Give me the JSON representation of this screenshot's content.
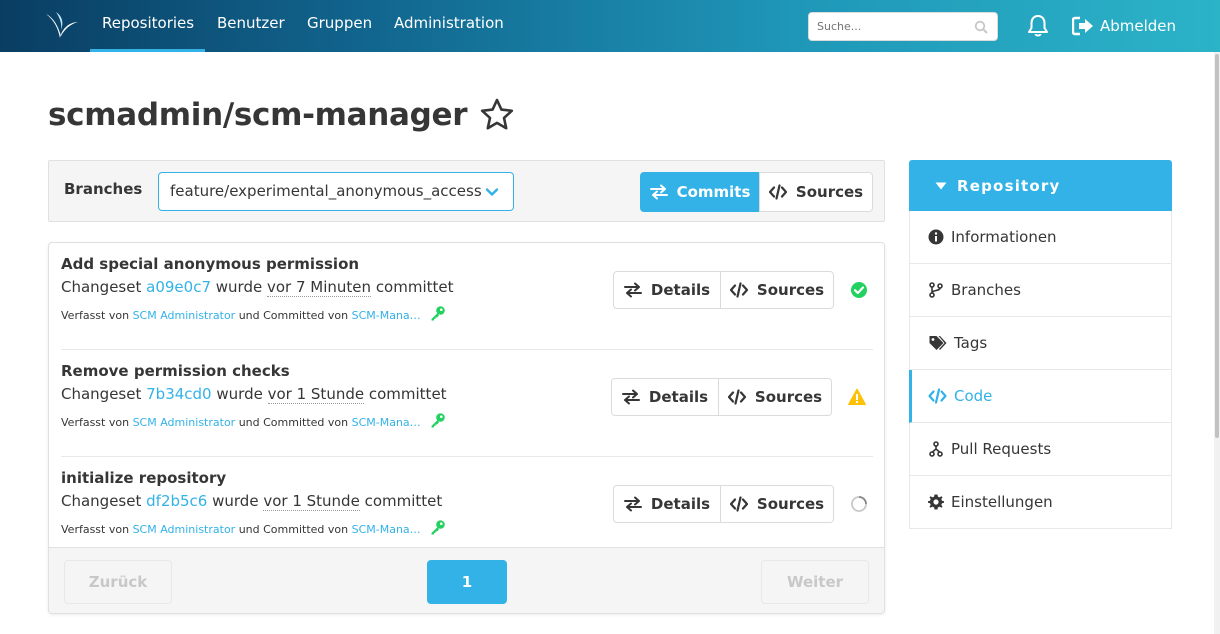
{
  "navbar": {
    "items": [
      "Repositories",
      "Benutzer",
      "Gruppen",
      "Administration"
    ],
    "search_placeholder": "Suche...",
    "logout_label": "Abmelden"
  },
  "page": {
    "title": "scmadmin/scm-manager"
  },
  "branches": {
    "label": "Branches",
    "selected": "feature/experimental_anonymous_access",
    "commits_label": "Commits",
    "sources_label": "Sources"
  },
  "changesets": [
    {
      "title": "Add special anonymous permission",
      "prefix": "Changeset",
      "hash": "a09e0c7",
      "mid": "wurde",
      "time": "vor 7 Minuten",
      "suffix": "committet",
      "authored_by": "Verfasst von",
      "author": "SCM Administrator",
      "committed_by": "und Committed von",
      "committer": "SCM-Mana…",
      "details_label": "Details",
      "sources_label": "Sources",
      "status": "success"
    },
    {
      "title": "Remove permission checks",
      "prefix": "Changeset",
      "hash": "7b34cd0",
      "mid": "wurde",
      "time": "vor 1 Stunde",
      "suffix": "committet",
      "authored_by": "Verfasst von",
      "author": "SCM Administrator",
      "committed_by": "und Committed von",
      "committer": "SCM-Mana…",
      "details_label": "Details",
      "sources_label": "Sources",
      "status": "warning"
    },
    {
      "title": "initialize repository",
      "prefix": "Changeset",
      "hash": "df2b5c6",
      "mid": "wurde",
      "time": "vor 1 Stunde",
      "suffix": "committet",
      "authored_by": "Verfasst von",
      "author": "SCM Administrator",
      "committed_by": "und Committed von",
      "committer": "SCM-Mana…",
      "details_label": "Details",
      "sources_label": "Sources",
      "status": "pending"
    }
  ],
  "pagination": {
    "prev_label": "Zurück",
    "page": "1",
    "next_label": "Weiter"
  },
  "sidebar": {
    "header": "Repository",
    "items": [
      {
        "label": "Informationen",
        "icon": "info-circle-icon"
      },
      {
        "label": "Branches",
        "icon": "code-branch-icon"
      },
      {
        "label": "Tags",
        "icon": "tags-icon"
      },
      {
        "label": "Code",
        "icon": "code-icon",
        "active": true
      },
      {
        "label": "Pull Requests",
        "icon": "pull-request-icon"
      },
      {
        "label": "Einstellungen",
        "icon": "cog-icon"
      }
    ]
  },
  "colors": {
    "primary": "#33b2e8",
    "success": "#23d160",
    "warning": "#ffc106",
    "key": "#23d160"
  }
}
